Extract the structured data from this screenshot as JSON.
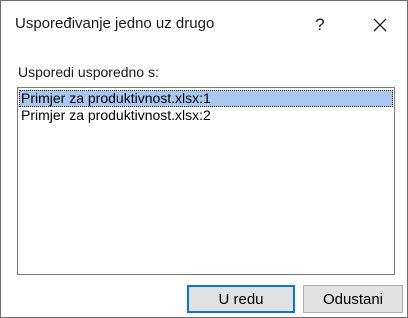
{
  "dialog": {
    "title": "Uspoređivanje jedno uz drugo",
    "help_label": "?",
    "list_label": "Usporedi usporedno s:",
    "items": [
      {
        "label": "Primjer za produktivnost.xlsx:1",
        "selected": true
      },
      {
        "label": "Primjer za produktivnost.xlsx:2",
        "selected": false
      }
    ],
    "ok_label": "U redu",
    "cancel_label": "Odustani"
  },
  "icons": {
    "close": "close-icon"
  },
  "colors": {
    "selection": "#a8c6ee",
    "default_button_border": "#0078d7",
    "button_face": "#e1e1e1"
  }
}
